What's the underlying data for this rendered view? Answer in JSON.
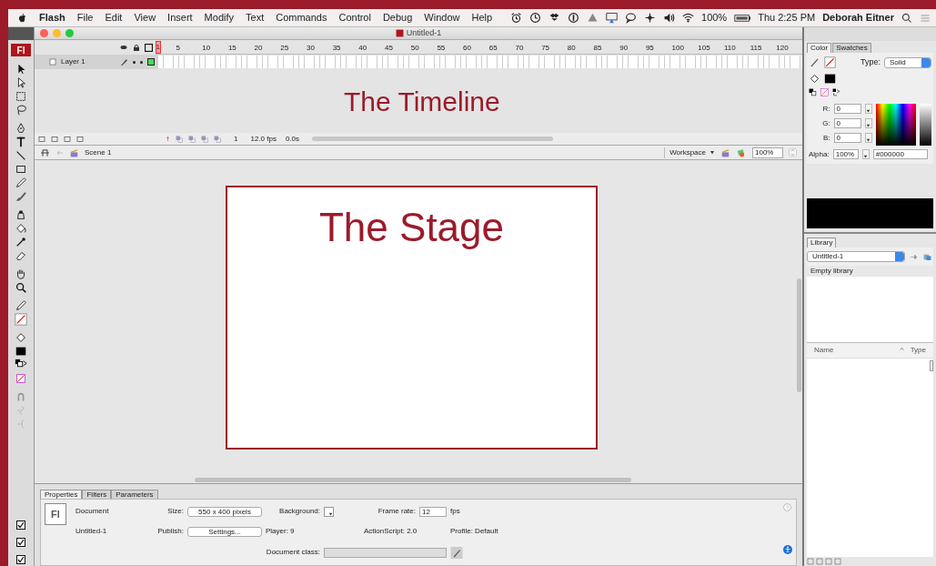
{
  "menu_bar": {
    "app": "Flash",
    "items": [
      "File",
      "Edit",
      "View",
      "Insert",
      "Modify",
      "Text",
      "Commands",
      "Control",
      "Debug",
      "Window",
      "Help"
    ],
    "battery": "100%",
    "clock": "Thu 2:25 PM",
    "user": "Deborah Eitner"
  },
  "window": {
    "title": "Untitled-1"
  },
  "tools": {
    "logo": "Fl",
    "checkboxes": [
      {
        "checked": true
      },
      {
        "checked": true
      },
      {
        "checked": true
      }
    ]
  },
  "timeline": {
    "frame_numbers": [
      "1",
      "5",
      "10",
      "15",
      "20",
      "25",
      "30",
      "35",
      "40",
      "45",
      "50",
      "55",
      "60",
      "65",
      "70",
      "75",
      "80",
      "85",
      "90",
      "95",
      "100",
      "105",
      "110",
      "115",
      "120"
    ],
    "layers": [
      {
        "name": "Layer 1",
        "selected": true
      }
    ],
    "annotation": "The Timeline",
    "current_frame": "1",
    "fps": "12.0 fps",
    "time": "0.0s"
  },
  "edit_bar": {
    "scene": "Scene 1",
    "workspace": "Workspace",
    "zoom": "100%"
  },
  "stage": {
    "caption": "The Stage"
  },
  "properties": {
    "tabs": [
      {
        "label": "Properties",
        "selected": true
      },
      {
        "label": "Filters",
        "selected": false
      },
      {
        "label": "Parameters",
        "selected": false
      }
    ],
    "logo": "Fl",
    "doc_type": "Document",
    "doc_name": "Untitled-1",
    "size_label": "Size:",
    "size_value": "550 x 400 pixels",
    "publish_label": "Publish:",
    "publish_button": "Settings...",
    "background_label": "Background:",
    "frame_rate_label": "Frame rate:",
    "frame_rate": "12",
    "fps_unit": "fps",
    "player": "Player: 9",
    "actionscript": "ActionScript: 2.0",
    "profile": "Profile: Default",
    "class_label": "Document class:"
  },
  "color_panel": {
    "tabs": [
      {
        "label": "Color",
        "selected": true
      },
      {
        "label": "Swatches",
        "selected": false
      }
    ],
    "type_label": "Type:",
    "type_value": "Solid",
    "channels": [
      {
        "label": "R:",
        "value": "0"
      },
      {
        "label": "G:",
        "value": "0"
      },
      {
        "label": "B:",
        "value": "0"
      }
    ],
    "alpha_label": "Alpha:",
    "alpha_value": "100%",
    "hex": "#000000"
  },
  "library": {
    "tabs": [
      {
        "label": "Library",
        "selected": true
      }
    ],
    "document": "Untitled-1",
    "status": "Empty library",
    "columns": [
      "Name",
      "Type"
    ]
  }
}
